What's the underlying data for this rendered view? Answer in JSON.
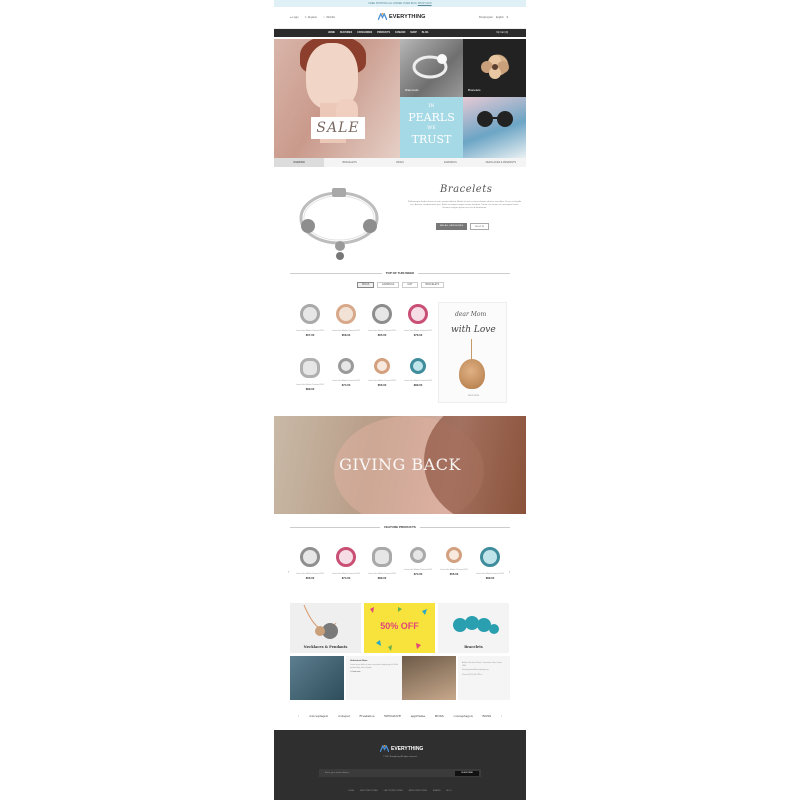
{
  "topbar": {
    "text": "FREE SHIPPING ALL ORDER OVER $100.",
    "link": "SHOP NOW"
  },
  "header": {
    "left_links": [
      "Login",
      "Register",
      "Wishlist"
    ],
    "logo": "EVERYTHING",
    "right_links": [
      "Shoppingcart",
      "English",
      "$"
    ]
  },
  "nav": {
    "items": [
      "HOME",
      "FEATURES",
      "CATEGORIES",
      "PRODUCTS",
      "FASHION",
      "SHOP",
      "BLOG"
    ],
    "cart": "My Cart (0)"
  },
  "hero": {
    "sale": "SALE",
    "tile_diamond": "Diamonds",
    "tile_bracelet": "Bracelets",
    "pearl_line1": "IN",
    "pearl_line2": "PEARLS",
    "pearl_line3": "WE",
    "pearl_line4": "TRUST"
  },
  "tabs": [
    "DIAMOND",
    "BRACELETS",
    "RINGS",
    "EARRINGS",
    "NECKLACES & PENDANTS"
  ],
  "feature": {
    "title": "Bracelets",
    "description": "Pellentesque finibus lorem at sem suscipit efficitur. Morbi vel nisi ut massa lacinia ultricies non dolor. Fusce et fringilla orci. Aenean condimentum quis. Etiam ut semper neque ornare tincidunt. Donec nec lorem vel consequat luctus. Vivamus congue ipsum nec nisi id fermentum.",
    "btn_primary": "SEE ALL CATEGORIES",
    "btn_secondary": "SHOP IN"
  },
  "top_week": {
    "title": "TOP OF THIS WEEK",
    "filters": [
      "RINGS",
      "EARRINGS",
      "GIFT",
      "BRACELETS"
    ],
    "products": [
      {
        "name": "Lorem Infini Maiden Diamond 2019",
        "price": "$57.00"
      },
      {
        "name": "Lorem Infini Maiden Diamond 2019",
        "price": "$58.00"
      },
      {
        "name": "Lorem Infini Maiden Diamond 2019",
        "price": "$65.00"
      },
      {
        "name": "Lorem Infini Maiden Diamond 2019",
        "price": "$76.00"
      },
      {
        "name": "Lorem Infini Maiden Diamond 2019",
        "price": "$89.00"
      },
      {
        "name": "Lorem Infini Maiden Diamond 2019",
        "price": "$74.00"
      },
      {
        "name": "Lorem Infini Maiden Diamond 2019",
        "price": "$56.00"
      },
      {
        "name": "Lorem Infini Maiden Diamond 2019",
        "price": "$89.00"
      }
    ],
    "promo_line1": "dear Mom",
    "promo_line2": "with Love",
    "promo_caption": "SHOP NOW"
  },
  "giving_back": "GIVING BACK",
  "feature_products": {
    "title": "FEATURE PRODUCTS",
    "products": [
      {
        "name": "Lorem Infini Maiden Diamond 2019",
        "price": "$56.00"
      },
      {
        "name": "Lorem Infini Maiden Diamond 2019",
        "price": "$74.00"
      },
      {
        "name": "Lorem Infini Maiden Diamond 2019",
        "price": "$89.00"
      },
      {
        "name": "Lorem Infini Maiden Diamond 2019",
        "price": "$74.00"
      },
      {
        "name": "Lorem Infini Maiden Diamond 2019",
        "price": "$56.00"
      },
      {
        "name": "Lorem Infini Maiden Diamond 2019",
        "price": "$89.00"
      }
    ]
  },
  "banners": {
    "left": "Necklaces & Pendants",
    "middle": "50% OFF",
    "right": "Bracelets"
  },
  "blog": {
    "title": "Unfinished Glam",
    "desc": "Lorem ipsum dolor sit amet consectetur adipiscing elit. Nulla gravida dolor vitae volutpat.",
    "more": "> Read more",
    "contact": [
      "Address Ecclesia Street, Corrections, New Castle, USA",
      "Email:youremail@everything.com",
      "Phone:(0123) 456 789 xx"
    ]
  },
  "brands": [
    "conceptagon",
    "codepel",
    "Freelance",
    "WEDANCE",
    "appframe",
    "BOSS",
    "conceptagon",
    "BOSS"
  ],
  "footer": {
    "logo": "EVERYTHING",
    "copyright": "© 2017 Everything. All rights reserved.",
    "newsletter_placeholder": "Enter your email address",
    "subscribe": "SUBSCRIBE",
    "links": [
      "HOME",
      "SHOP DIRECTORIES",
      "LADY'S DIRECTORIES",
      "MEN'S DIRECTORIES",
      "BRANDS",
      "BLOG"
    ]
  },
  "colors": {
    "accent": "#2b2b2b",
    "topbar": "#dff1f6",
    "footer": "#2f2f2f",
    "sale_yellow": "#f7e33b"
  }
}
